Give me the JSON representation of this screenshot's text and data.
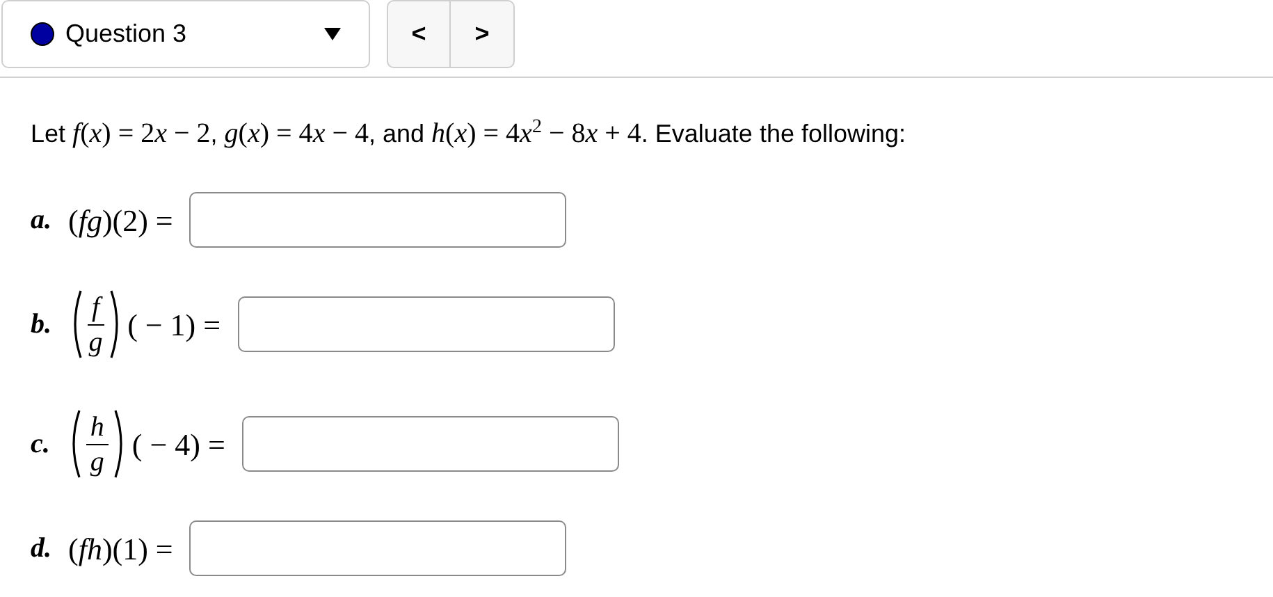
{
  "question_select": {
    "label": "Question 3",
    "color": "#0000a0"
  },
  "nav": {
    "prev": "<",
    "next": ">"
  },
  "prompt": [
    {
      "kind": "text",
      "text": "Let "
    },
    {
      "kind": "var",
      "text": "f"
    },
    {
      "kind": "math",
      "text": "("
    },
    {
      "kind": "var",
      "text": "x"
    },
    {
      "kind": "math",
      "text": ") = 2"
    },
    {
      "kind": "var",
      "text": "x"
    },
    {
      "kind": "math",
      "text": " − 2"
    },
    {
      "kind": "text",
      "text": ", "
    },
    {
      "kind": "var",
      "text": "g"
    },
    {
      "kind": "math",
      "text": "("
    },
    {
      "kind": "var",
      "text": "x"
    },
    {
      "kind": "math",
      "text": ") = 4"
    },
    {
      "kind": "var",
      "text": "x"
    },
    {
      "kind": "math",
      "text": " − 4"
    },
    {
      "kind": "text",
      "text": ", and "
    },
    {
      "kind": "var",
      "text": "h"
    },
    {
      "kind": "math",
      "text": "("
    },
    {
      "kind": "var",
      "text": "x"
    },
    {
      "kind": "math",
      "text": ") = 4"
    },
    {
      "kind": "var",
      "text": "x"
    },
    {
      "kind": "sup",
      "text": "2"
    },
    {
      "kind": "math",
      "text": " − 8"
    },
    {
      "kind": "var",
      "text": "x"
    },
    {
      "kind": "math",
      "text": " + 4"
    },
    {
      "kind": "text",
      "text": ". Evaluate the following:"
    }
  ],
  "parts": [
    {
      "kind": "inline",
      "label": "a.",
      "expression": "(*fg*)(2) ="
    },
    {
      "kind": "fraction",
      "label": "b.",
      "numerator": "f",
      "denominator": "g",
      "expression": "( − 1) ="
    },
    {
      "kind": "fraction",
      "label": "c.",
      "numerator": "h",
      "denominator": "g",
      "expression": "( − 4) ="
    },
    {
      "kind": "inline",
      "label": "d.",
      "expression": "(*fh*)(1) ="
    }
  ]
}
